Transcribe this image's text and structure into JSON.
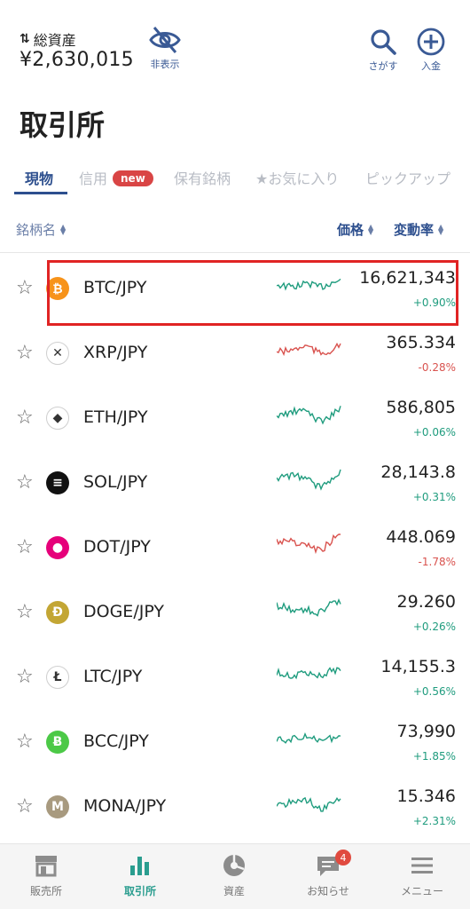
{
  "header": {
    "asset_label": "総資産",
    "asset_value": "¥2,630,015",
    "hide_label": "非表示",
    "search_label": "さがす",
    "deposit_label": "入金"
  },
  "page_title": "取引所",
  "tabs": [
    {
      "label": "現物"
    },
    {
      "label": "信用",
      "badge": "new"
    },
    {
      "label": "保有銘柄"
    },
    {
      "label": "★お気に入り"
    },
    {
      "label": "ピックアップ"
    }
  ],
  "columns": {
    "name": "銘柄名",
    "price": "価格",
    "change": "変動率"
  },
  "colors": {
    "up": "#1f9c7e",
    "down": "#d9534f",
    "accent": "#2d4f8e"
  },
  "rows": [
    {
      "pair": "BTC/JPY",
      "price": "16,621,343",
      "change": "+0.90%",
      "dir": "up",
      "icon": "bitcoin-icon",
      "glyph": "₿",
      "color": "#f7931a"
    },
    {
      "pair": "XRP/JPY",
      "price": "365.334",
      "change": "-0.28%",
      "dir": "down",
      "icon": "xrp-icon",
      "glyph": "✕",
      "color": "#ffffff"
    },
    {
      "pair": "ETH/JPY",
      "price": "586,805",
      "change": "+0.06%",
      "dir": "up",
      "icon": "ethereum-icon",
      "glyph": "◆",
      "color": "#ffffff"
    },
    {
      "pair": "SOL/JPY",
      "price": "28,143.8",
      "change": "+0.31%",
      "dir": "up",
      "icon": "solana-icon",
      "glyph": "≡",
      "color": "#111111"
    },
    {
      "pair": "DOT/JPY",
      "price": "448.069",
      "change": "-1.78%",
      "dir": "down",
      "icon": "polkadot-icon",
      "glyph": "●",
      "color": "#e6007a"
    },
    {
      "pair": "DOGE/JPY",
      "price": "29.260",
      "change": "+0.26%",
      "dir": "up",
      "icon": "dogecoin-icon",
      "glyph": "Ð",
      "color": "#c3a634"
    },
    {
      "pair": "LTC/JPY",
      "price": "14,155.3",
      "change": "+0.56%",
      "dir": "up",
      "icon": "litecoin-icon",
      "glyph": "Ł",
      "color": "#ffffff"
    },
    {
      "pair": "BCC/JPY",
      "price": "73,990",
      "change": "+1.85%",
      "dir": "up",
      "icon": "bitcoin-cash-icon",
      "glyph": "Ƀ",
      "color": "#4cc947"
    },
    {
      "pair": "MONA/JPY",
      "price": "15.346",
      "change": "+2.31%",
      "dir": "up",
      "icon": "monacoin-icon",
      "glyph": "M",
      "color": "#a89a7f"
    }
  ],
  "bottom_nav": [
    {
      "label": "販売所",
      "icon": "shop-icon"
    },
    {
      "label": "取引所",
      "icon": "bar-chart-icon"
    },
    {
      "label": "資産",
      "icon": "pie-chart-icon"
    },
    {
      "label": "お知らせ",
      "icon": "message-icon",
      "badge": "4"
    },
    {
      "label": "メニュー",
      "icon": "menu-icon"
    }
  ]
}
